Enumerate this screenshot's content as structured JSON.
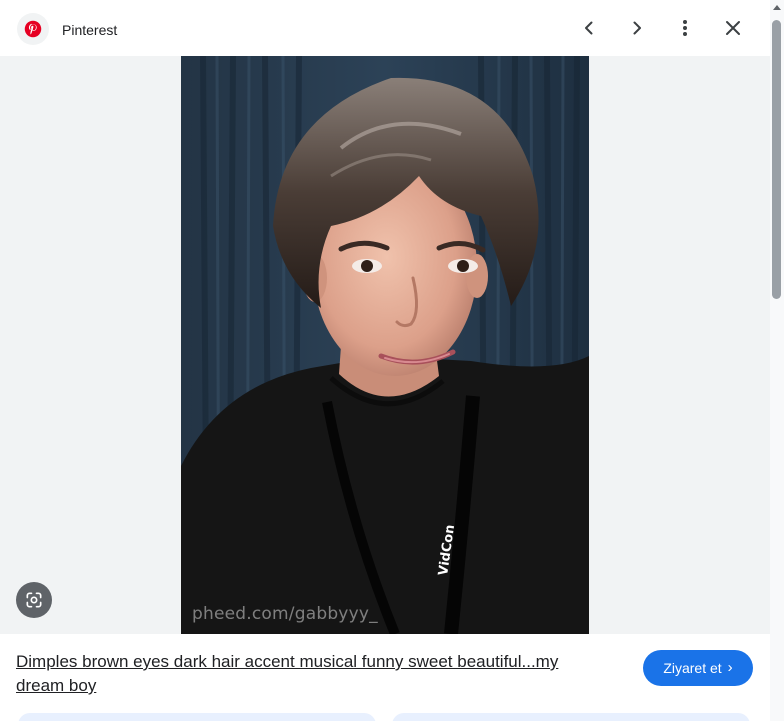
{
  "header": {
    "source_name": "Pinterest",
    "logo_icon": "pinterest-logo-icon",
    "brand_color": "#E60023",
    "prev_icon": "chevron-left-icon",
    "next_icon": "chevron-right-icon",
    "more_icon": "more-vert-icon",
    "close_icon": "close-icon"
  },
  "image": {
    "watermark": "pheed.com/gabbyyy_",
    "lanyard_text": "VidCon",
    "lens_icon": "lens-search-icon"
  },
  "result": {
    "caption": "Dimples brown eyes dark hair accent musical funny sweet beautiful...my dream boy",
    "visit_label": "Ziyaret et",
    "visit_icon": "chevron-right-icon",
    "accent_color": "#1A73E8"
  }
}
